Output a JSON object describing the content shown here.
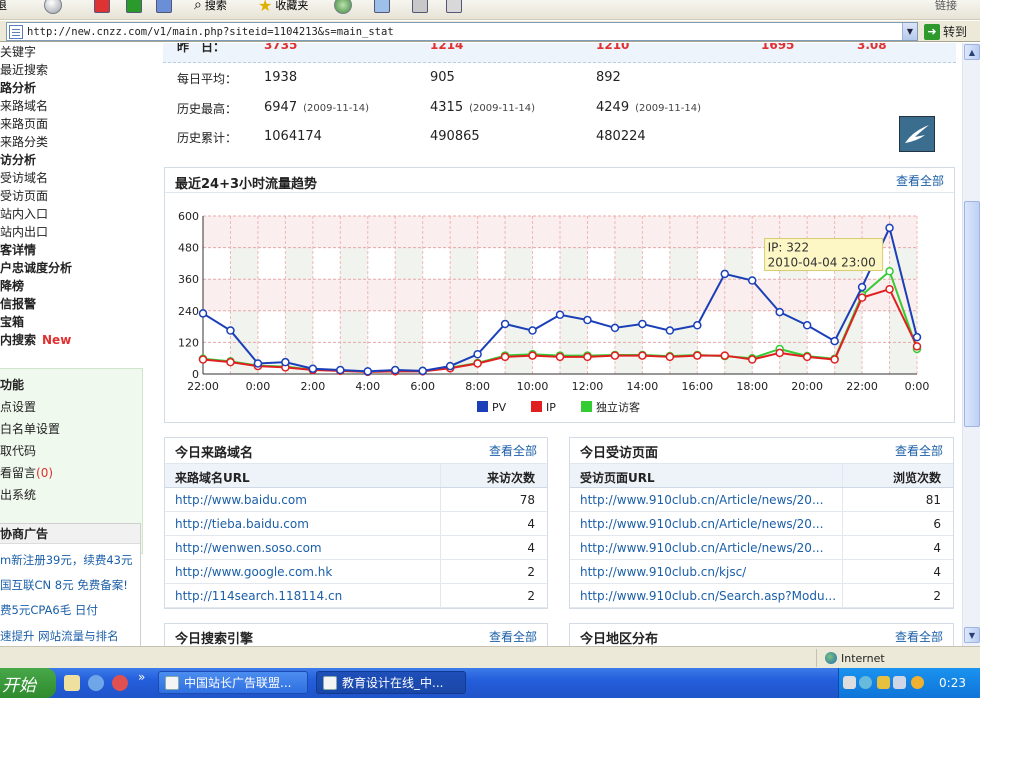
{
  "browser": {
    "toolbar": {
      "search_label": "搜索",
      "favorites_label": "收藏夹",
      "right_label": "链接"
    },
    "address": "http://new.cnzz.com/v1/main.php?siteid=1104213&s=main_stat",
    "go_label": "转到"
  },
  "sidebar": {
    "items": [
      {
        "label": "关键字",
        "bold": false
      },
      {
        "label": "最近搜索",
        "bold": false
      },
      {
        "label": "路分析",
        "bold": true
      },
      {
        "label": "来路域名",
        "bold": false
      },
      {
        "label": "来路页面",
        "bold": false
      },
      {
        "label": "来路分类",
        "bold": false
      },
      {
        "label": "访分析",
        "bold": true
      },
      {
        "label": "受访域名",
        "bold": false
      },
      {
        "label": "受访页面",
        "bold": false
      },
      {
        "label": "站内入口",
        "bold": false
      },
      {
        "label": "站内出口",
        "bold": false
      },
      {
        "label": "客详情",
        "bold": true
      },
      {
        "label": "户忠诚度分析",
        "bold": true
      },
      {
        "label": "降榜",
        "bold": true
      },
      {
        "label": "信报警",
        "bold": true
      },
      {
        "label": "宝箱",
        "bold": true
      },
      {
        "label": "内搜索",
        "bold": true
      }
    ],
    "new_badge": "New",
    "functions": {
      "title": "功能",
      "items": [
        "点设置",
        "白名单设置",
        "取代码",
        "看留言",
        "出系统"
      ],
      "message_count": "(0)"
    },
    "ads": {
      "title": "协商广告",
      "lines": [
        "m新注册39元，续费43元",
        "国互联CN 8元 免费备案!",
        "费5元CPA6毛 日付",
        "速提升 网站流量与排名"
      ]
    }
  },
  "stats": {
    "yesterday": {
      "label": "昨　日：",
      "values": [
        "3735",
        "1214",
        "1210",
        "1695",
        "3.08"
      ]
    },
    "daily_avg": {
      "label": "每日平均：",
      "values": [
        "1938",
        "905",
        "892"
      ]
    },
    "history_high": {
      "label": "历史最高：",
      "values": [
        {
          "value": "6947",
          "date": "(2009-11-14)"
        },
        {
          "value": "4315",
          "date": "(2009-11-14)"
        },
        {
          "value": "4249",
          "date": "(2009-11-14)"
        }
      ]
    },
    "history_total": {
      "label": "历史累计：",
      "values": [
        "1064174",
        "490865",
        "480224"
      ]
    }
  },
  "trend": {
    "title": "最近24+3小时流量趋势",
    "more": "查看全部",
    "tooltip": {
      "line1": "IP: 322",
      "line2": "2010-04-04 23:00"
    }
  },
  "chart_data": {
    "type": "line",
    "x": [
      "22:00",
      "23:00",
      "0:00",
      "1:00",
      "2:00",
      "3:00",
      "4:00",
      "5:00",
      "6:00",
      "7:00",
      "8:00",
      "9:00",
      "10:00",
      "11:00",
      "12:00",
      "13:00",
      "14:00",
      "15:00",
      "16:00",
      "17:00",
      "18:00",
      "19:00",
      "20:00",
      "21:00",
      "22:00",
      "23:00",
      "0:00"
    ],
    "x_tick_labels": [
      "22:00",
      "0:00",
      "2:00",
      "4:00",
      "6:00",
      "8:00",
      "10:00",
      "12:00",
      "14:00",
      "16:00",
      "18:00",
      "20:00",
      "22:00",
      "0:00"
    ],
    "series": [
      {
        "name": "PV",
        "color": "#1a3fb8",
        "values": [
          230,
          165,
          40,
          45,
          20,
          15,
          10,
          15,
          12,
          30,
          75,
          190,
          165,
          225,
          205,
          175,
          190,
          165,
          185,
          380,
          355,
          235,
          185,
          125,
          330,
          555,
          140
        ]
      },
      {
        "name": "IP",
        "color": "#e02020",
        "values": [
          55,
          45,
          30,
          25,
          15,
          12,
          8,
          10,
          10,
          22,
          40,
          65,
          70,
          65,
          65,
          70,
          70,
          65,
          70,
          70,
          55,
          80,
          65,
          55,
          290,
          322,
          105
        ]
      },
      {
        "name": "独立访客",
        "color": "#33cc33",
        "values": [
          58,
          48,
          32,
          28,
          16,
          13,
          9,
          11,
          12,
          24,
          42,
          70,
          75,
          70,
          70,
          72,
          72,
          68,
          72,
          68,
          60,
          95,
          68,
          58,
          300,
          390,
          95
        ]
      }
    ],
    "ylim": [
      0,
      600
    ],
    "yticks": [
      0,
      120,
      240,
      360,
      480,
      600
    ],
    "grid": true,
    "legend": "bottom"
  },
  "referrers": {
    "title": "今日来路域名",
    "more": "查看全部",
    "col_url": "来路域名URL",
    "col_count": "来访次数",
    "rows": [
      {
        "url": "http://www.baidu.com",
        "count": "78"
      },
      {
        "url": "http://tieba.baidu.com",
        "count": "4"
      },
      {
        "url": "http://wenwen.soso.com",
        "count": "4"
      },
      {
        "url": "http://www.google.com.hk",
        "count": "2"
      },
      {
        "url": "http://114search.118114.cn",
        "count": "2"
      }
    ]
  },
  "visited": {
    "title": "今日受访页面",
    "more": "查看全部",
    "col_url": "受访页面URL",
    "col_count": "浏览次数",
    "rows": [
      {
        "url": "http://www.910club.cn/Article/news/20...",
        "count": "81"
      },
      {
        "url": "http://www.910club.cn/Article/news/20...",
        "count": "6"
      },
      {
        "url": "http://www.910club.cn/Article/news/20...",
        "count": "4"
      },
      {
        "url": "http://www.910club.cn/kjsc/",
        "count": "4"
      },
      {
        "url": "http://www.910club.cn/Search.asp?Modu...",
        "count": "2"
      }
    ]
  },
  "search_engines": {
    "title": "今日搜索引擎",
    "more": "查看全部"
  },
  "regions": {
    "title": "今日地区分布",
    "more": "查看全部"
  },
  "status_bar": {
    "zone": "Internet"
  },
  "taskbar": {
    "start": "开始",
    "tasks": [
      "中国站长广告联盟...",
      "教育设计在线_中..."
    ],
    "clock": "0:23"
  }
}
